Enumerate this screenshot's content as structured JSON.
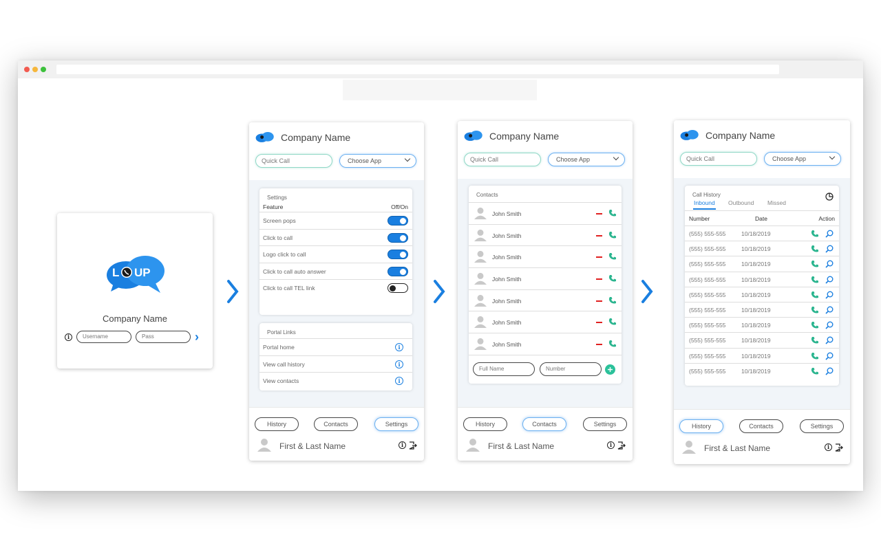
{
  "login": {
    "company": "Company Name",
    "username_placeholder": "Username",
    "password_placeholder": "Pass",
    "logo_text": "LOUP"
  },
  "app_header": {
    "title": "Company Name",
    "quick_call_placeholder": "Quick Call",
    "choose_app": "Choose App"
  },
  "nav": {
    "history": "History",
    "contacts": "Contacts",
    "settings": "Settings"
  },
  "user": {
    "name": "First & Last Name"
  },
  "settings": {
    "title": "Settings",
    "col_feature": "Feature",
    "col_state": "Off/On",
    "features": [
      {
        "label": "Screen pops",
        "on": true
      },
      {
        "label": "Click to call",
        "on": true
      },
      {
        "label": "Logo click to call",
        "on": true
      },
      {
        "label": "Click to call auto answer",
        "on": true
      },
      {
        "label": "Click to call TEL link",
        "on": false
      }
    ],
    "portal_title": "Portal Links",
    "portal_links": [
      "Portal home",
      "View call history",
      "View contacts"
    ]
  },
  "contacts": {
    "title": "Contacts",
    "names": [
      "John Smith",
      "John Smith",
      "John Smith",
      "John Smith",
      "John Smith",
      "John Smith",
      "John Smith"
    ],
    "full_name_placeholder": "Full Name",
    "number_placeholder": "Number"
  },
  "history": {
    "title": "Call History",
    "tabs": [
      "Inbound",
      "Outbound",
      "Missed"
    ],
    "col_number": "Number",
    "col_date": "Date",
    "col_action": "Action",
    "rows": [
      {
        "number": "(555) 555-555",
        "date": "10/18/2019"
      },
      {
        "number": "(555) 555-555",
        "date": "10/18/2019"
      },
      {
        "number": "(555) 555-555",
        "date": "10/18/2019"
      },
      {
        "number": "(555) 555-555",
        "date": "10/18/2019"
      },
      {
        "number": "(555) 555-555",
        "date": "10/18/2019"
      },
      {
        "number": "(555) 555-555",
        "date": "10/18/2019"
      },
      {
        "number": "(555) 555-555",
        "date": "10/18/2019"
      },
      {
        "number": "(555) 555-555",
        "date": "10/18/2019"
      },
      {
        "number": "(555) 555-555",
        "date": "10/18/2019"
      },
      {
        "number": "(555) 555-555",
        "date": "10/18/2019"
      }
    ]
  },
  "colors": {
    "accent": "#1a7fe0",
    "call_green": "#2bb58f",
    "hangup_red": "#e02020"
  }
}
